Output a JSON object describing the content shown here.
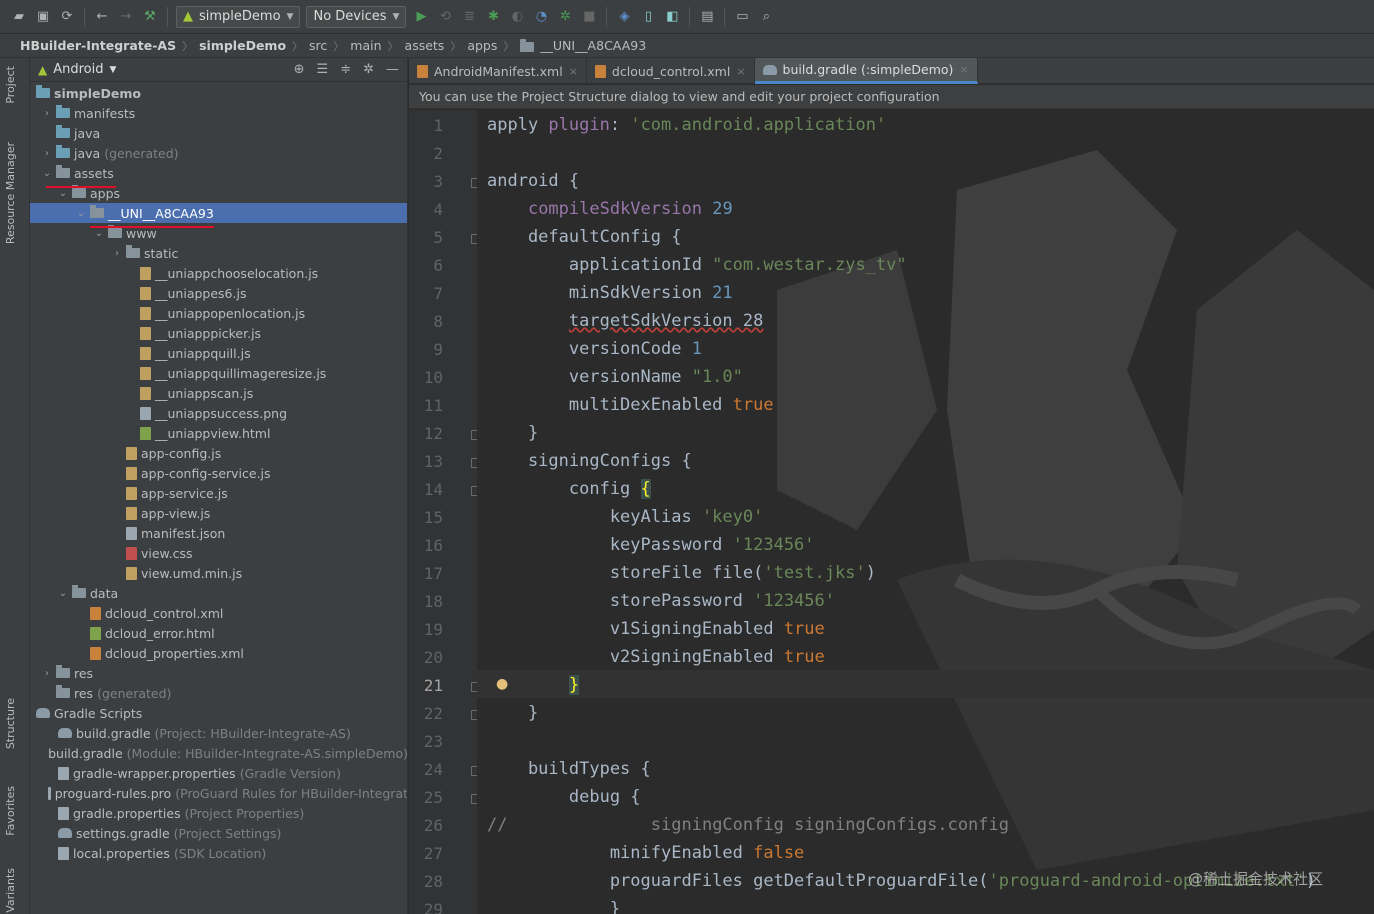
{
  "toolbar": {
    "config_combo": "simpleDemo",
    "device_combo": "No Devices"
  },
  "breadcrumb": {
    "project": "HBuilder-Integrate-AS",
    "module": "simpleDemo",
    "path": [
      "src",
      "main",
      "assets",
      "apps"
    ],
    "current": "__UNI__A8CAA93"
  },
  "left_stripe": {
    "tabs": [
      "Project",
      "Resource Manager",
      "Structure",
      "Favorites",
      "Variants"
    ]
  },
  "panel": {
    "view_selector": "Android"
  },
  "tree": [
    {
      "label": "simpleDemo",
      "bold": true,
      "icon": "module-folder"
    },
    {
      "label": "manifests",
      "icon": "folder-blue"
    },
    {
      "label": "java",
      "icon": "folder-blue"
    },
    {
      "label": "java",
      "note": "(generated)",
      "icon": "folder-blue"
    },
    {
      "label": "assets",
      "icon": "folder"
    },
    {
      "label": "apps",
      "icon": "folder"
    },
    {
      "label": "__UNI__A8CAA93",
      "icon": "folder",
      "selected": true
    },
    {
      "label": "www",
      "icon": "folder"
    },
    {
      "label": "static",
      "icon": "folder"
    },
    {
      "label": "__uniappchooselocation.js",
      "icon": "js"
    },
    {
      "label": "__uniappes6.js",
      "icon": "js"
    },
    {
      "label": "__uniappopenlocation.js",
      "icon": "js"
    },
    {
      "label": "__uniapppicker.js",
      "icon": "js"
    },
    {
      "label": "__uniappquill.js",
      "icon": "js"
    },
    {
      "label": "__uniappquillimageresize.js",
      "icon": "js"
    },
    {
      "label": "__uniappscan.js",
      "icon": "js"
    },
    {
      "label": "__uniappsuccess.png",
      "icon": "file"
    },
    {
      "label": "__uniappview.html",
      "icon": "html"
    },
    {
      "label": "app-config.js",
      "icon": "js"
    },
    {
      "label": "app-config-service.js",
      "icon": "js"
    },
    {
      "label": "app-service.js",
      "icon": "js"
    },
    {
      "label": "app-view.js",
      "icon": "js"
    },
    {
      "label": "manifest.json",
      "icon": "file"
    },
    {
      "label": "view.css",
      "icon": "css"
    },
    {
      "label": "view.umd.min.js",
      "icon": "js"
    },
    {
      "label": "data",
      "icon": "folder"
    },
    {
      "label": "dcloud_control.xml",
      "icon": "xml"
    },
    {
      "label": "dcloud_error.html",
      "icon": "html"
    },
    {
      "label": "dcloud_properties.xml",
      "icon": "xml"
    },
    {
      "label": "res",
      "icon": "folder"
    },
    {
      "label": "res",
      "note": "(generated)",
      "icon": "folder"
    },
    {
      "label": "Gradle Scripts",
      "icon": "gradle"
    },
    {
      "label": "build.gradle",
      "note": "(Project: HBuilder-Integrate-AS)",
      "icon": "gradle"
    },
    {
      "label": "build.gradle",
      "note": "(Module: HBuilder-Integrate-AS.simpleDemo)",
      "icon": "gradle"
    },
    {
      "label": "gradle-wrapper.properties",
      "note": "(Gradle Version)",
      "icon": "file"
    },
    {
      "label": "proguard-rules.pro",
      "note": "(ProGuard Rules for HBuilder-Integrat",
      "icon": "file"
    },
    {
      "label": "gradle.properties",
      "note": "(Project Properties)",
      "icon": "file"
    },
    {
      "label": "settings.gradle",
      "note": "(Project Settings)",
      "icon": "gradle"
    },
    {
      "label": "local.properties",
      "note": "(SDK Location)",
      "icon": "file"
    }
  ],
  "editor_tabs": [
    {
      "label": "AndroidManifest.xml",
      "active": false
    },
    {
      "label": "dcloud_control.xml",
      "active": false
    },
    {
      "label": "build.gradle (:simpleDemo)",
      "active": true
    }
  ],
  "banner": "You can use the Project Structure dialog to view and edit your project configuration",
  "current_line": 21,
  "code": [
    [
      [
        "kw0",
        "apply "
      ],
      [
        "prop",
        "plugin"
      ],
      [
        "kw0",
        ": "
      ],
      [
        "str",
        "'com.android.application'"
      ]
    ],
    [],
    [
      [
        "kw0",
        "android {"
      ]
    ],
    [
      [
        "kw0",
        "    "
      ],
      [
        "prop",
        "compileSdkVersion"
      ],
      [
        "kw0",
        " "
      ],
      [
        "num",
        "29"
      ]
    ],
    [
      [
        "kw0",
        "    defaultConfig {"
      ]
    ],
    [
      [
        "kw0",
        "        applicationId "
      ],
      [
        "str",
        "\"com.westar.zys_tv\""
      ]
    ],
    [
      [
        "kw0",
        "        minSdkVersion "
      ],
      [
        "num",
        "21"
      ]
    ],
    [
      [
        "kw0",
        "        "
      ],
      [
        "err",
        "targetSdkVersion 28"
      ]
    ],
    [
      [
        "kw0",
        "        versionCode "
      ],
      [
        "num",
        "1"
      ]
    ],
    [
      [
        "kw0",
        "        versionName "
      ],
      [
        "str",
        "\"1.0\""
      ]
    ],
    [
      [
        "kw0",
        "        multiDexEnabled "
      ],
      [
        "kw",
        "true"
      ]
    ],
    [
      [
        "kw0",
        "    }"
      ]
    ],
    [
      [
        "kw0",
        "    signingConfigs {"
      ]
    ],
    [
      [
        "kw0",
        "        config "
      ],
      [
        "hl",
        "{"
      ]
    ],
    [
      [
        "kw0",
        "            keyAlias "
      ],
      [
        "str",
        "'key0'"
      ]
    ],
    [
      [
        "kw0",
        "            keyPassword "
      ],
      [
        "str",
        "'123456'"
      ]
    ],
    [
      [
        "kw0",
        "            storeFile file("
      ],
      [
        "str",
        "'test.jks'"
      ],
      [
        "kw0",
        ")"
      ]
    ],
    [
      [
        "kw0",
        "            storePassword "
      ],
      [
        "str",
        "'123456'"
      ]
    ],
    [
      [
        "kw0",
        "            v1SigningEnabled "
      ],
      [
        "kw",
        "true"
      ]
    ],
    [
      [
        "kw0",
        "            v2SigningEnabled "
      ],
      [
        "kw",
        "true"
      ]
    ],
    [
      [
        "kw0",
        "        "
      ],
      [
        "hl",
        "}"
      ]
    ],
    [
      [
        "kw0",
        "    }"
      ]
    ],
    [],
    [
      [
        "kw0",
        "    buildTypes {"
      ]
    ],
    [
      [
        "kw0",
        "        debug {"
      ]
    ],
    [
      [
        "cmt",
        "//"
      ],
      [
        "kw0",
        "              "
      ],
      [
        "cmt",
        "signingConfig signingConfigs.config"
      ]
    ],
    [
      [
        "kw0",
        "            minifyEnabled "
      ],
      [
        "kw",
        "false"
      ]
    ],
    [
      [
        "kw0",
        "            proguardFiles getDefaultProguardFile("
      ],
      [
        "str",
        "'proguard-android-optimize.txt'"
      ],
      [
        "kw0",
        ")"
      ]
    ],
    [
      [
        "kw0",
        "            }"
      ]
    ]
  ],
  "watermark": "@稀土掘金技术社区"
}
